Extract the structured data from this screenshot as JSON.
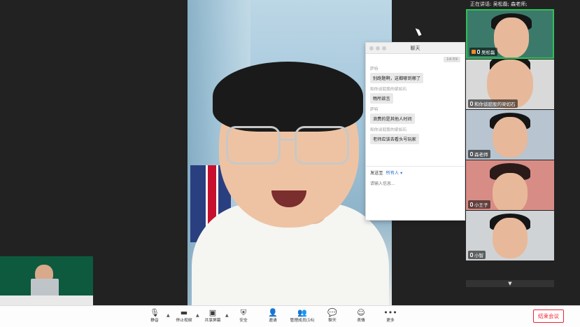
{
  "speaking": "正在讲话: 吴松磊; 森老师;",
  "chat": {
    "title": "聊天",
    "time": "14:59",
    "messages": [
      {
        "sender": "萨特",
        "text": "别跑题啊，这都哪到哪了"
      },
      {
        "sender": "和你谈屁股的梁如石",
        "text": "畅所欲言"
      },
      {
        "sender": "萨特",
        "text": "浪费的是其他人时间"
      },
      {
        "sender": "和你谈屁股的梁如石",
        "text": "老师应该去看头号玩家"
      }
    ],
    "send_to_label": "发送至",
    "send_to_target": "所有人",
    "input_placeholder": "请输入信息..."
  },
  "gallery": [
    {
      "name": "吴松磊",
      "host": true,
      "active": true
    },
    {
      "name": "和你谈屁股的梁如石",
      "host": false,
      "active": false
    },
    {
      "name": "森老师",
      "host": false,
      "active": false
    },
    {
      "name": "小王子",
      "host": false,
      "active": false
    },
    {
      "name": "小智",
      "host": false,
      "active": false
    }
  ],
  "toolbar": {
    "items": [
      {
        "label": "静音",
        "icon": "microphone-icon",
        "glyph": "🎙"
      },
      {
        "label": "停止视频",
        "icon": "video-camera-icon",
        "glyph": "▬"
      },
      {
        "label": "共享屏幕",
        "icon": "share-screen-icon",
        "glyph": "▣"
      },
      {
        "label": "安全",
        "icon": "shield-icon",
        "glyph": "⛨"
      },
      {
        "label": "邀请",
        "icon": "add-user-icon",
        "glyph": "👤"
      },
      {
        "label": "管理成员(16)",
        "icon": "participants-icon",
        "glyph": "👥"
      },
      {
        "label": "聊天",
        "icon": "chat-icon",
        "glyph": "💬"
      },
      {
        "label": "表情",
        "icon": "emoji-icon",
        "glyph": "☺"
      },
      {
        "label": "更多",
        "icon": "more-icon",
        "glyph": "•••"
      }
    ],
    "end_label": "结束会议"
  },
  "colors": {
    "active_border": "#2fbf55",
    "end_red": "#e22233",
    "link_blue": "#2b6fd6"
  }
}
